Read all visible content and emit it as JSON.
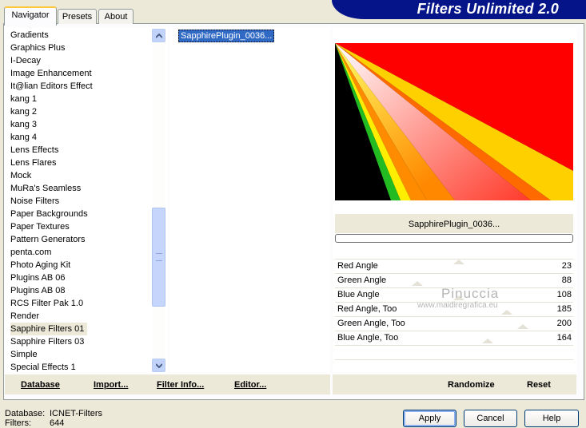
{
  "app": {
    "title": "Filters Unlimited 2.0"
  },
  "tabs": [
    {
      "label": "Navigator"
    },
    {
      "label": "Presets"
    },
    {
      "label": "About"
    }
  ],
  "categories": [
    "Gradients",
    "Graphics Plus",
    "I-Decay",
    "Image Enhancement",
    "It@lian Editors Effect",
    "kang 1",
    "kang 2",
    "kang 3",
    "kang 4",
    "Lens Effects",
    "Lens Flares",
    "Mock",
    "MuRa's Seamless",
    "Noise Filters",
    "Paper Backgrounds",
    "Paper Textures",
    "Pattern Generators",
    "penta.com",
    "Photo Aging Kit",
    "Plugins AB 06",
    "Plugins AB 08",
    "RCS Filter Pak 1.0",
    "Render",
    "Sapphire Filters 01",
    "Sapphire Filters 03",
    "Simple",
    "Special Effects 1"
  ],
  "selected_category": "Sapphire Filters 01",
  "filters": [
    "SapphirePlugin_0036..."
  ],
  "preview": {
    "filter_name": "SapphirePlugin_0036..."
  },
  "params": [
    {
      "label": "Red Angle",
      "value": "23"
    },
    {
      "label": "Green Angle",
      "value": "88"
    },
    {
      "label": "Blue Angle",
      "value": "108"
    },
    {
      "label": "Red Angle, Too",
      "value": "185"
    },
    {
      "label": "Green Angle, Too",
      "value": "200"
    },
    {
      "label": "Blue Angle, Too",
      "value": "164"
    }
  ],
  "watermark": {
    "line1": "Pinuccia",
    "line2": "www.maidiregrafica.eu"
  },
  "toolbar": {
    "database": "Database",
    "import": "Import...",
    "filter_info": "Filter Info...",
    "editor": "Editor...",
    "randomize": "Randomize",
    "reset": "Reset"
  },
  "footer": {
    "database_label": "Database:",
    "database_value": "ICNET-Filters",
    "filters_label": "Filters:",
    "filters_value": "644"
  },
  "buttons": {
    "apply": "Apply",
    "cancel": "Cancel",
    "help": "Help"
  },
  "colors": {
    "banner": "#06148a",
    "selection": "#316ac5",
    "tab_highlight": "#ffc83c"
  }
}
